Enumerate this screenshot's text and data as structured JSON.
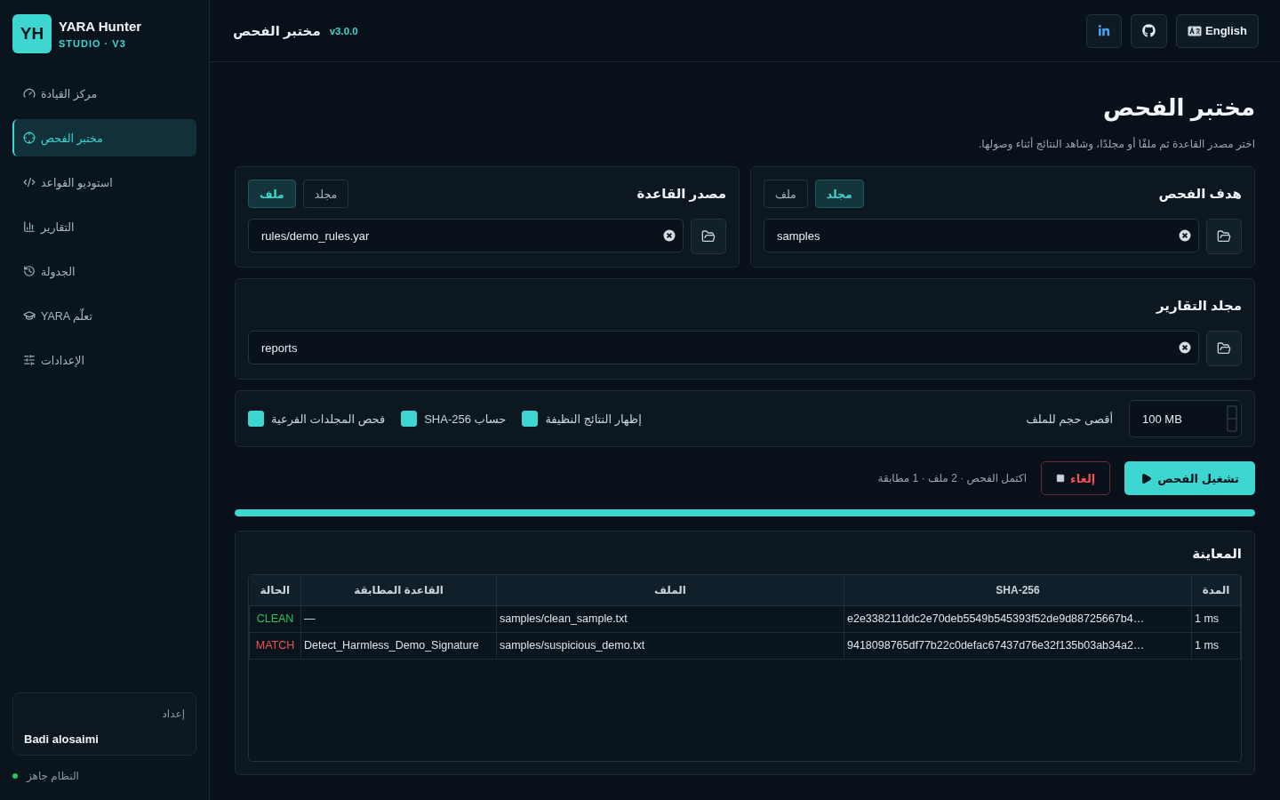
{
  "brand": {
    "logo": "YH",
    "name": "YARA Hunter",
    "subtitle": "STUDIO · V3"
  },
  "nav": [
    {
      "label": "مركز القيادة",
      "selected": false
    },
    {
      "label": "مختبر الفحص",
      "selected": true
    },
    {
      "label": "استوديو القواعد",
      "selected": false
    },
    {
      "label": "التقارير",
      "selected": false
    },
    {
      "label": "الجدولة",
      "selected": false
    },
    {
      "label": "YARA تعلّم",
      "selected": false
    },
    {
      "label": "الإعدادات",
      "selected": false
    }
  ],
  "profile": {
    "caption": "إعداد",
    "name": "Badi alosaimi"
  },
  "system_status": "النظام جاهز",
  "header": {
    "title": "مختبر الفحص",
    "version": "v3.0.0",
    "language": "English"
  },
  "page": {
    "title": "مختبر الفحص",
    "subtitle": "اختر مصدر القاعدة ثم ملفًا أو مجلدًا، وشاهد النتائج أثناء وصولها."
  },
  "sources": [
    {
      "title": "هدف الفحص",
      "options": [
        {
          "label": "مجلد",
          "selected": true
        },
        {
          "label": "ملف",
          "selected": false
        }
      ],
      "value": "samples"
    },
    {
      "title": "مصدر القاعدة",
      "options": [
        {
          "label": "مجلد",
          "selected": false
        },
        {
          "label": "ملف",
          "selected": true
        }
      ],
      "value": "rules/demo_rules.yar"
    }
  ],
  "reports": {
    "title": "مجلد التقارير",
    "value": "reports"
  },
  "options": {
    "max_size_label": "أقصى حجم للملف",
    "max_size": "100 MB",
    "checkboxes": [
      {
        "label": "إظهار النتائج النظيفة",
        "checked": true
      },
      {
        "label": "حساب SHA-256",
        "checked": true
      },
      {
        "label": "فحص المجلدات الفرعية",
        "checked": true
      }
    ]
  },
  "actions": {
    "run": "تشغيل الفحص",
    "cancel": "إلغاء",
    "status": "اكتمل الفحص · 2 ملف · 1 مطابقة"
  },
  "progress": {
    "level": 1
  },
  "preview": {
    "title": "المعاينة",
    "columns": [
      "المدة",
      "SHA-256",
      "الملف",
      "القاعدة المطابقة",
      "الحالة"
    ],
    "rows": [
      {
        "kind": "clean",
        "status": "CLEAN",
        "rule": "—",
        "file": "samples/clean_sample.txt",
        "sha": "e2e338211ddc2e70deb5549b545393f52de9d88725667b4…",
        "duration": "1 ms"
      },
      {
        "kind": "match",
        "status": "MATCH",
        "rule": "Detect_Harmless_Demo_Signature",
        "file": "samples/suspicious_demo.txt",
        "sha": "9418098765df77b22c0defac67437d76e32f135b03ab34a2…",
        "duration": "1 ms"
      }
    ]
  }
}
